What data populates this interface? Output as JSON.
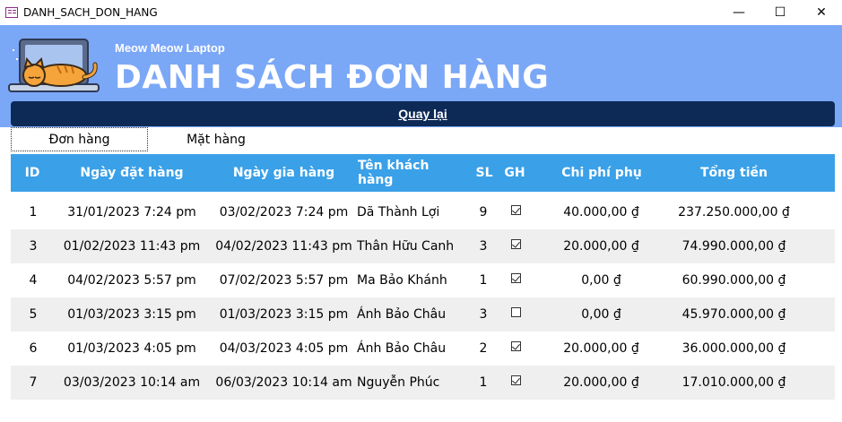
{
  "window": {
    "title": "DANH_SACH_DON_HANG",
    "controls": {
      "minimize": "—",
      "maximize": "☐",
      "close": "✕"
    }
  },
  "header": {
    "brand": "Meow Meow Laptop",
    "title": "DANH SÁCH ĐƠN HÀNG",
    "logo_icon": "cat-on-laptop-icon",
    "background": "#7ba7f7"
  },
  "back_button": {
    "label": "Quay lại",
    "color": "#0d2a57"
  },
  "tabs": [
    {
      "label": "Đơn hàng",
      "active": true
    },
    {
      "label": "Mặt hàng",
      "active": false
    }
  ],
  "table": {
    "header_color": "#3aa0e8",
    "columns": [
      "ID",
      "Ngày đặt hàng",
      "Ngày gia hàng",
      "Tên khách hàng",
      "SL",
      "GH",
      "Chi phí phụ",
      "Tổng tiền"
    ],
    "rows": [
      {
        "id": "1",
        "order_date": "31/01/2023 7:24 pm",
        "delivery_date": "03/02/2023 7:24 pm",
        "customer": "Dã Thành Lợi",
        "qty": "9",
        "delivered": true,
        "extra_fee": "40.000,00 ₫",
        "total": "237.250.000,00 ₫"
      },
      {
        "id": "3",
        "order_date": "01/02/2023 11:43 pm",
        "delivery_date": "04/02/2023 11:43 pm",
        "customer": "Thân Hữu Canh",
        "qty": "3",
        "delivered": true,
        "extra_fee": "20.000,00 ₫",
        "total": "74.990.000,00 ₫"
      },
      {
        "id": "4",
        "order_date": "04/02/2023 5:57 pm",
        "delivery_date": "07/02/2023 5:57 pm",
        "customer": "Ma Bảo Khánh",
        "qty": "1",
        "delivered": true,
        "extra_fee": "0,00 ₫",
        "total": "60.990.000,00 ₫"
      },
      {
        "id": "5",
        "order_date": "01/03/2023 3:15 pm",
        "delivery_date": "01/03/2023 3:15 pm",
        "customer": "Ánh Bảo Châu",
        "qty": "3",
        "delivered": false,
        "extra_fee": "0,00 ₫",
        "total": "45.970.000,00 ₫"
      },
      {
        "id": "6",
        "order_date": "01/03/2023 4:05 pm",
        "delivery_date": "04/03/2023 4:05 pm",
        "customer": "Ánh Bảo Châu",
        "qty": "2",
        "delivered": true,
        "extra_fee": "20.000,00 ₫",
        "total": "36.000.000,00 ₫"
      },
      {
        "id": "7",
        "order_date": "03/03/2023 10:14 am",
        "delivery_date": "06/03/2023 10:14 am",
        "customer": "Nguyễn Phúc",
        "qty": "1",
        "delivered": true,
        "extra_fee": "20.000,00 ₫",
        "total": "17.010.000,00 ₫"
      }
    ]
  }
}
